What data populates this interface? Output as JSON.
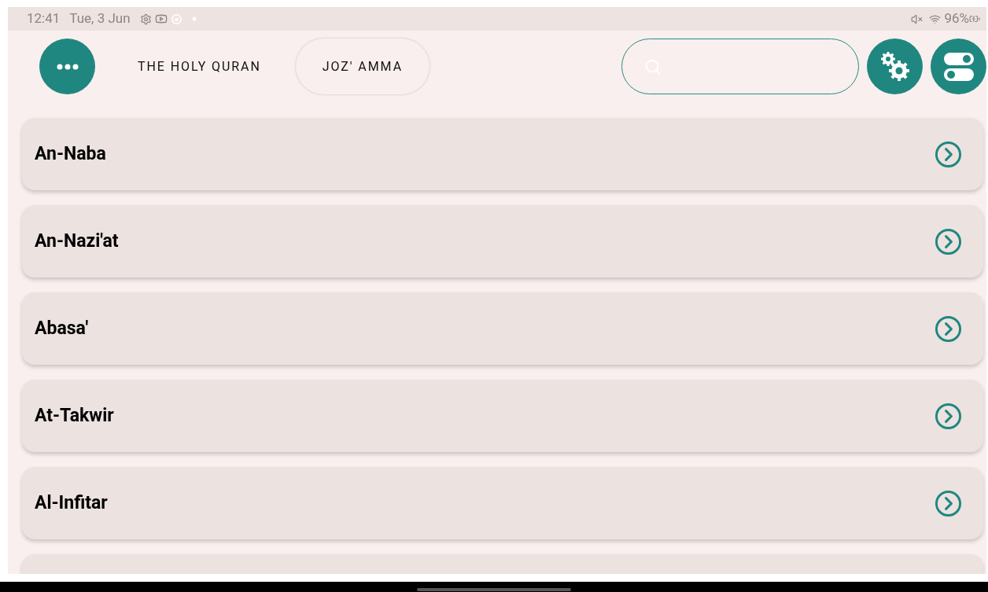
{
  "status_bar": {
    "time": "12:41",
    "date": "Tue, 3 Jun",
    "battery": "96%"
  },
  "header": {
    "tabs": [
      {
        "label": "THE HOLY QURAN",
        "selected": false
      },
      {
        "label": "JOZ' AMMA",
        "selected": true
      }
    ]
  },
  "surahs": [
    {
      "name": "An-Naba"
    },
    {
      "name": "An-Nazi'at"
    },
    {
      "name": "Abasa'"
    },
    {
      "name": "At-Takwir"
    },
    {
      "name": "Al-Infitar"
    }
  ]
}
